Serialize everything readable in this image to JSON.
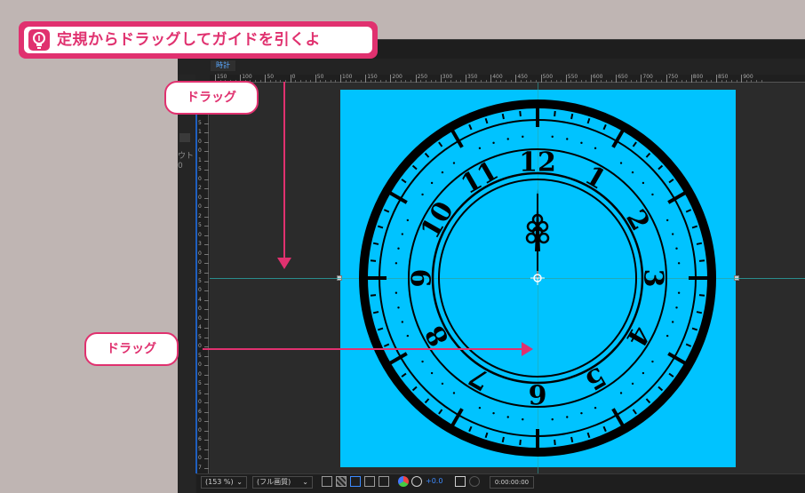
{
  "title": {
    "text": "定規からドラッグしてガイドを引くよ",
    "icon": "lightbulb-icon",
    "accent": "#e0316f"
  },
  "composition": {
    "tab_label": "時計",
    "canvas_color": "#00c3ff",
    "guide_color": "#2aa6a6"
  },
  "left_panel": {
    "label1": "ウト",
    "label2": "0"
  },
  "ruler_top": {
    "labels": [
      "150",
      "100",
      "50",
      "0",
      "50",
      "100",
      "150",
      "200",
      "250",
      "300",
      "350",
      "400",
      "450",
      "500",
      "550",
      "600",
      "650",
      "700",
      "750",
      "800",
      "850",
      "900"
    ]
  },
  "ruler_left": {
    "labels": [
      "1",
      "5",
      "0",
      "0",
      "5",
      "1",
      "0",
      "0",
      "1",
      "5",
      "0",
      "2",
      "0",
      "0",
      "2",
      "5",
      "0",
      "3",
      "0",
      "0",
      "3",
      "5",
      "0",
      "4",
      "0",
      "0",
      "4",
      "5",
      "0",
      "5",
      "0",
      "0",
      "5",
      "5",
      "0",
      "6",
      "0",
      "0",
      "6",
      "5",
      "0",
      "7"
    ]
  },
  "callouts": {
    "top": "ドラッグ",
    "left": "ドラッグ"
  },
  "clock": {
    "numbers": [
      "12",
      "1",
      "2",
      "3",
      "4",
      "5",
      "6",
      "7",
      "8",
      "9",
      "10",
      "11"
    ]
  },
  "bottom_bar": {
    "zoom": "(153 %)",
    "resolution": "(フル画質)",
    "exposure": "+0.0",
    "timecode": "0:00:00:00",
    "icons": [
      "mask-icon",
      "transparency-grid-icon",
      "region-icon",
      "safe-zone-icon",
      "grid-icon",
      "color-channel-icon",
      "exposure-reset-icon",
      "snapshot-icon",
      "show-snapshot-icon"
    ]
  }
}
